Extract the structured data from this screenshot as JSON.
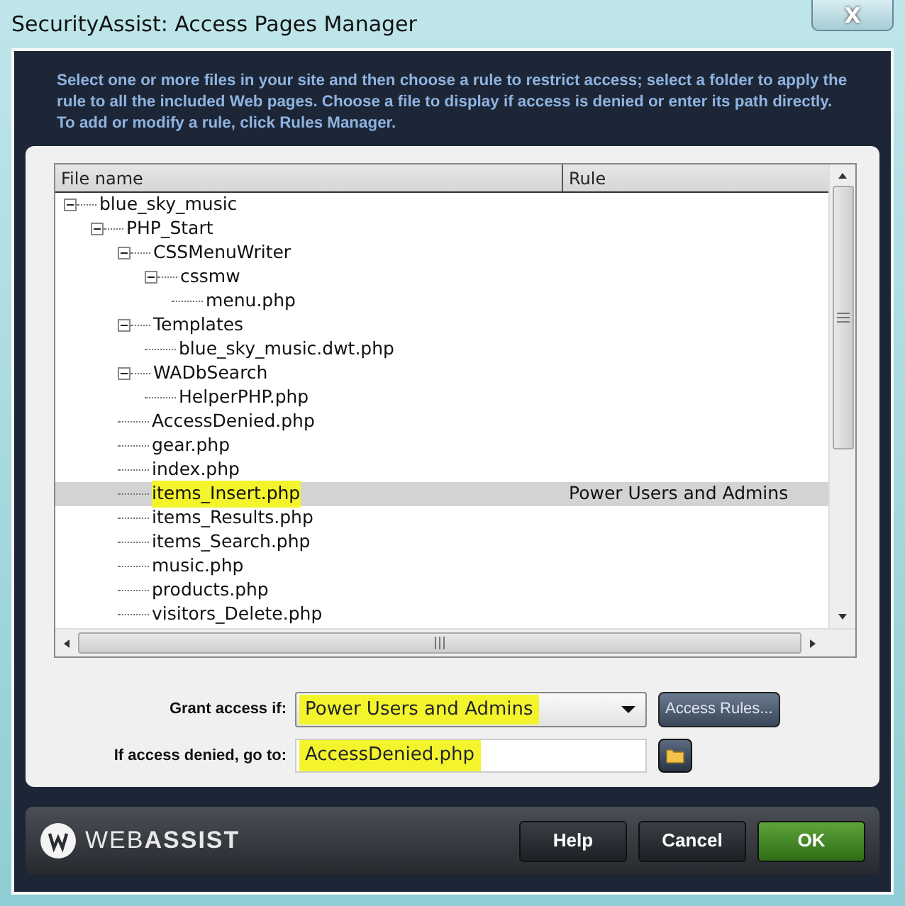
{
  "window": {
    "title": "SecurityAssist: Access Pages Manager",
    "close": "X"
  },
  "instructions": "Select one or more files in your site and then choose a rule to restrict access; select a folder to apply the rule to all the included Web pages. Choose a file to display if access is denied or enter its path directly. To add or modify a rule, click Rules Manager.",
  "tree": {
    "columns": [
      "File name",
      "Rule"
    ],
    "items": [
      {
        "name": "blue_sky_music",
        "expanded": true,
        "selected": false,
        "children": [
          {
            "name": "PHP_Start",
            "expanded": true,
            "selected": false,
            "children": [
              {
                "name": "CSSMenuWriter",
                "expanded": true,
                "selected": false,
                "children": [
                  {
                    "name": "cssmw",
                    "expanded": true,
                    "selected": false,
                    "children": [
                      {
                        "name": "menu.php",
                        "selected": false
                      }
                    ]
                  }
                ]
              },
              {
                "name": "Templates",
                "expanded": true,
                "selected": false,
                "children": [
                  {
                    "name": "blue_sky_music.dwt.php",
                    "selected": false
                  }
                ]
              },
              {
                "name": "WADbSearch",
                "expanded": true,
                "selected": false,
                "children": [
                  {
                    "name": "HelperPHP.php",
                    "selected": false
                  }
                ]
              },
              {
                "name": "AccessDenied.php",
                "selected": false
              },
              {
                "name": "gear.php",
                "selected": false
              },
              {
                "name": "index.php",
                "selected": false
              },
              {
                "name": "items_Insert.php",
                "rule": "Power Users and Admins",
                "selected": true,
                "highlighted": true
              },
              {
                "name": "items_Results.php",
                "selected": false
              },
              {
                "name": "items_Search.php",
                "selected": false
              },
              {
                "name": "music.php",
                "selected": false
              },
              {
                "name": "products.php",
                "selected": false
              },
              {
                "name": "visitors_Delete.php",
                "selected": false
              }
            ]
          }
        ]
      }
    ]
  },
  "grant_access": {
    "label": "Grant access if:",
    "value": "Power Users and Admins",
    "highlighted": true,
    "button": "Access Rules..."
  },
  "denied": {
    "label": "If access denied, go to:",
    "value": "AccessDenied.php",
    "highlighted": true
  },
  "footer": {
    "logo": "WEB**ASSIST**",
    "buttons": [
      {
        "label": "Help",
        "kind": "normal"
      },
      {
        "label": "Cancel",
        "kind": "normal"
      },
      {
        "label": "OK",
        "kind": "primary"
      }
    ]
  }
}
